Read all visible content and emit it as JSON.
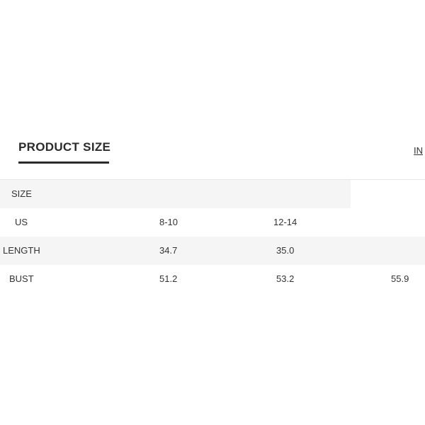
{
  "tabs": {
    "active_label": "PRODUCT SIZE",
    "unit_toggle": "IN"
  },
  "table": {
    "header": "SIZE",
    "rows": [
      {
        "label": "US",
        "values": [
          "8-10",
          "12-14",
          ""
        ]
      },
      {
        "label": "LENGTH",
        "values": [
          "34.7",
          "35.0",
          ""
        ]
      },
      {
        "label": "BUST",
        "values": [
          "51.2",
          "53.2",
          "55.9"
        ]
      }
    ]
  }
}
